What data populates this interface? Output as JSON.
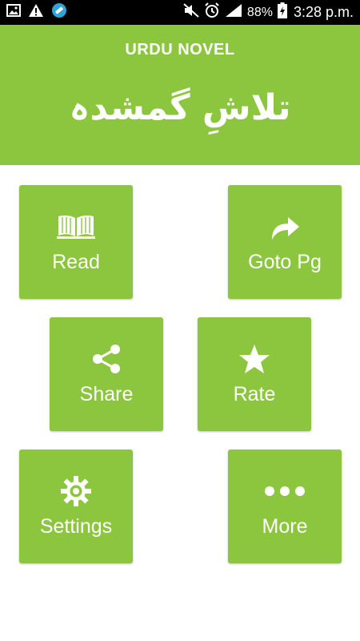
{
  "status_bar": {
    "battery": "88%",
    "time": "3:28 p.m."
  },
  "header": {
    "app_title": "URDU NOVEL",
    "novel_title": "تلاشِ گمشدہ",
    "background": "#8cc63f"
  },
  "tiles": [
    {
      "label": "Read",
      "icon": "book-icon"
    },
    {
      "label": "Goto Pg",
      "icon": "share-arrow-icon"
    },
    {
      "label": "Share",
      "icon": "share-icon"
    },
    {
      "label": "Rate",
      "icon": "star-icon"
    },
    {
      "label": "Settings",
      "icon": "gear-icon"
    },
    {
      "label": "More",
      "icon": "more-dots-icon"
    }
  ],
  "colors": {
    "accent": "#8cc63f",
    "status_bar": "#000000",
    "text": "#ffffff"
  }
}
